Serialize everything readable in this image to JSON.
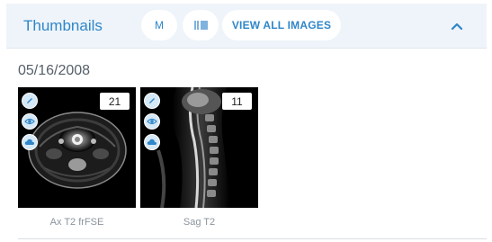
{
  "panel": {
    "title": "Thumbnails",
    "buttons": {
      "m_label": "M",
      "layout_icon": "series-layout-icon",
      "view_all_label": "VIEW ALL IMAGES"
    },
    "collapse_icon": "chevron-up-icon"
  },
  "study": {
    "date": "05/16/2008",
    "series": [
      {
        "caption": "Ax T2 frFSE",
        "image_count": "21",
        "tools": [
          "pencil-icon",
          "eye-icon",
          "cloud-icon"
        ]
      },
      {
        "caption": "Sag T2",
        "image_count": "11",
        "tools": [
          "pencil-icon",
          "eye-icon",
          "cloud-icon"
        ]
      }
    ]
  },
  "colors": {
    "accent": "#2f86c9",
    "header_bg": "#eef4f9",
    "tool_bg": "#d5e8f6"
  }
}
